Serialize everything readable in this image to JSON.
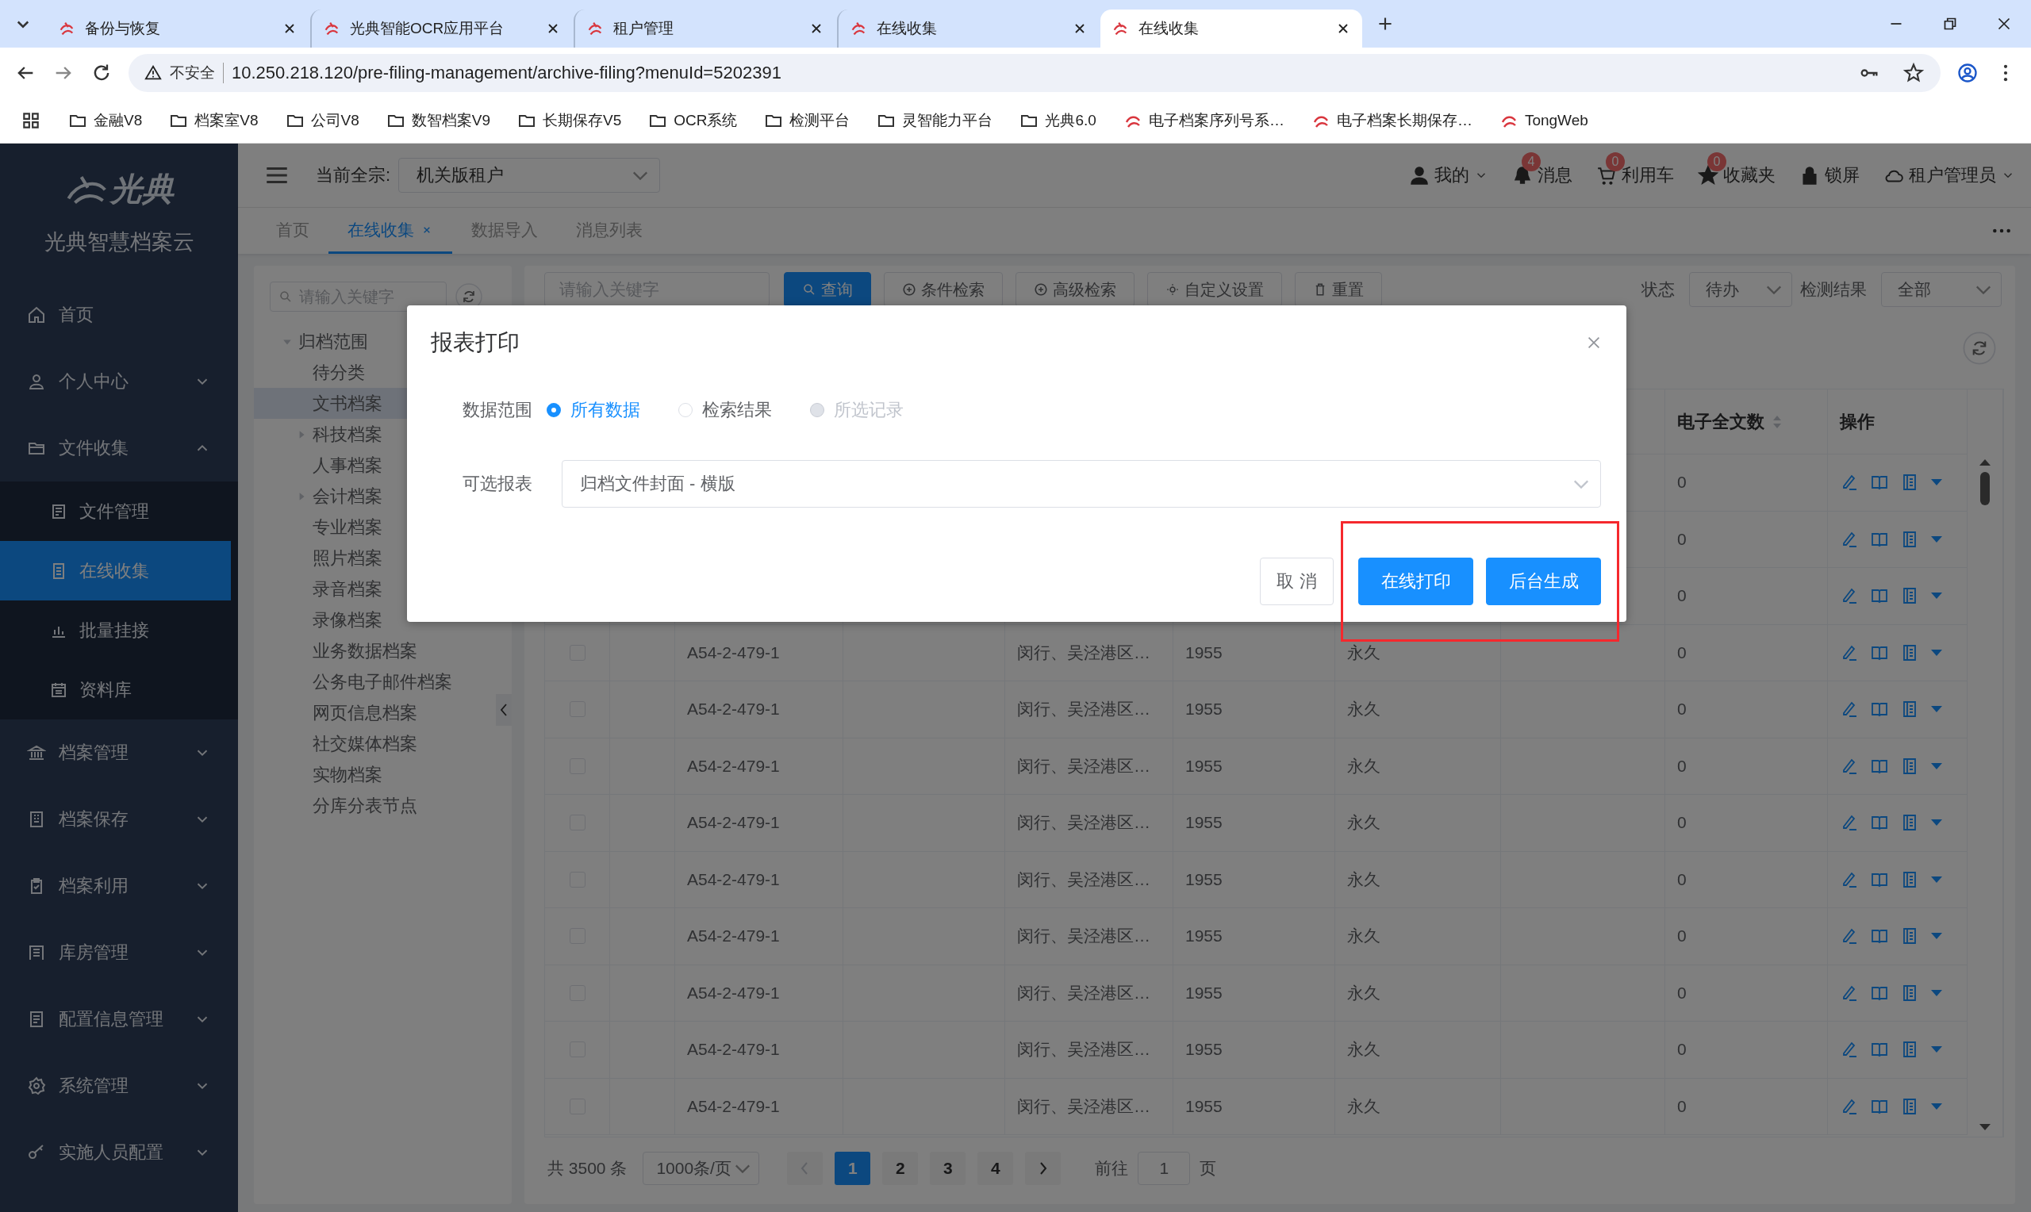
{
  "browser": {
    "tabs": [
      {
        "title": "备份与恢复",
        "selected": false
      },
      {
        "title": "光典智能OCR应用平台",
        "selected": false
      },
      {
        "title": "租户管理",
        "selected": false
      },
      {
        "title": "在线收集",
        "selected": false
      },
      {
        "title": "在线收集",
        "selected": true
      }
    ],
    "address": {
      "security": "不安全",
      "url": "10.250.218.120/pre-filing-management/archive-filing?menuId=5202391"
    },
    "bookmarks": [
      {
        "label": "金融V8",
        "kind": "folder"
      },
      {
        "label": "档案室V8",
        "kind": "folder"
      },
      {
        "label": "公司V8",
        "kind": "folder"
      },
      {
        "label": "数智档案V9",
        "kind": "folder"
      },
      {
        "label": "长期保存V5",
        "kind": "folder"
      },
      {
        "label": "OCR系统",
        "kind": "folder"
      },
      {
        "label": "检测平台",
        "kind": "folder"
      },
      {
        "label": "灵智能力平台",
        "kind": "folder"
      },
      {
        "label": "光典6.0",
        "kind": "folder"
      },
      {
        "label": "电子档案序列号系…",
        "kind": "page"
      },
      {
        "label": "电子档案长期保存…",
        "kind": "page"
      },
      {
        "label": "TongWeb",
        "kind": "page"
      }
    ]
  },
  "sidebar": {
    "logo": "光典",
    "title": "光典智慧档案云",
    "items": [
      {
        "label": "首页",
        "kind": "link",
        "selected": false
      },
      {
        "label": "个人中心",
        "kind": "group",
        "expanded": false
      },
      {
        "label": "文件收集",
        "kind": "group",
        "expanded": true,
        "children": [
          {
            "label": "文件管理",
            "selected": false
          },
          {
            "label": "在线收集",
            "selected": true
          },
          {
            "label": "批量挂接",
            "selected": false
          },
          {
            "label": "资料库",
            "selected": false
          }
        ]
      },
      {
        "label": "档案管理",
        "kind": "group",
        "expanded": false
      },
      {
        "label": "档案保存",
        "kind": "group",
        "expanded": false
      },
      {
        "label": "档案利用",
        "kind": "group",
        "expanded": false
      },
      {
        "label": "库房管理",
        "kind": "group",
        "expanded": false
      },
      {
        "label": "配置信息管理",
        "kind": "group",
        "expanded": false
      },
      {
        "label": "系统管理",
        "kind": "group",
        "expanded": false
      },
      {
        "label": "实施人员配置",
        "kind": "group",
        "expanded": false
      }
    ]
  },
  "header": {
    "fonds_label": "当前全宗:",
    "fonds": "机关版租户",
    "actions": [
      {
        "label": "我的",
        "kind": "user",
        "dropdown": true
      },
      {
        "label": "消息",
        "kind": "bell",
        "badge": "4",
        "dropdown": false
      },
      {
        "label": "利用车",
        "kind": "cart",
        "badge": "0",
        "dropdown": false
      },
      {
        "label": "收藏夹",
        "kind": "star",
        "badge": "0",
        "dropdown": false
      },
      {
        "label": "锁屏",
        "kind": "lock",
        "dropdown": false
      },
      {
        "label": "租户管理员",
        "kind": "cloud",
        "dropdown": true
      }
    ]
  },
  "page_tabs": [
    {
      "label": "首页",
      "selected": false,
      "closable": false
    },
    {
      "label": "在线收集",
      "selected": true,
      "closable": true
    },
    {
      "label": "数据导入",
      "selected": false,
      "closable": false
    },
    {
      "label": "消息列表",
      "selected": false,
      "closable": false
    }
  ],
  "tree": {
    "placeholder": "请输入关键字",
    "nodes": [
      {
        "label": "归档范围",
        "expanded": true,
        "selected": false,
        "children": [
          {
            "label": "待分类",
            "selected": false
          },
          {
            "label": "文书档案",
            "selected": true
          },
          {
            "label": "科技档案",
            "selected": false,
            "expanded": false
          },
          {
            "label": "人事档案",
            "selected": false
          },
          {
            "label": "会计档案",
            "selected": false,
            "expanded": false
          },
          {
            "label": "专业档案",
            "selected": false
          },
          {
            "label": "照片档案",
            "selected": false
          },
          {
            "label": "录音档案",
            "selected": false
          },
          {
            "label": "录像档案",
            "selected": false
          },
          {
            "label": "业务数据档案",
            "selected": false
          },
          {
            "label": "公务电子邮件档案",
            "selected": false
          },
          {
            "label": "网页信息档案",
            "selected": false
          },
          {
            "label": "社交媒体档案",
            "selected": false
          },
          {
            "label": "实物档案",
            "selected": false
          },
          {
            "label": "分库分表节点",
            "selected": false
          }
        ]
      }
    ]
  },
  "toolbar": {
    "placeholder": "请输入关键字",
    "buttons": [
      {
        "label": "查询",
        "kind": "primary"
      },
      {
        "label": "条件检索",
        "kind": "plain"
      },
      {
        "label": "高级检索",
        "kind": "plain"
      },
      {
        "label": "自定义设置",
        "kind": "plain"
      },
      {
        "label": "重置",
        "kind": "plain"
      }
    ],
    "filters": [
      {
        "label": "状态",
        "value": "待办"
      },
      {
        "label": "检测结果",
        "value": "全部"
      }
    ]
  },
  "table": {
    "columns": [
      {
        "label": "电子全文数",
        "sortable": true
      },
      {
        "label": "操作",
        "sortable": false
      }
    ],
    "rows": [
      {
        "count": "0"
      },
      {
        "count": "0"
      },
      {
        "count": "0"
      },
      {
        "checked": false,
        "code": "A54-2-479-1",
        "place": "闵行、吴泾港区…",
        "year": "1955",
        "term": "永久",
        "count": "0"
      },
      {
        "checked": false,
        "code": "A54-2-479-1",
        "place": "闵行、吴泾港区…",
        "year": "1955",
        "term": "永久",
        "count": "0"
      },
      {
        "checked": false,
        "code": "A54-2-479-1",
        "place": "闵行、吴泾港区…",
        "year": "1955",
        "term": "永久",
        "count": "0"
      },
      {
        "checked": false,
        "code": "A54-2-479-1",
        "place": "闵行、吴泾港区…",
        "year": "1955",
        "term": "永久",
        "count": "0"
      },
      {
        "checked": false,
        "code": "A54-2-479-1",
        "place": "闵行、吴泾港区…",
        "year": "1955",
        "term": "永久",
        "count": "0"
      },
      {
        "checked": false,
        "code": "A54-2-479-1",
        "place": "闵行、吴泾港区…",
        "year": "1955",
        "term": "永久",
        "count": "0"
      },
      {
        "checked": false,
        "code": "A54-2-479-1",
        "place": "闵行、吴泾港区…",
        "year": "1955",
        "term": "永久",
        "count": "0"
      },
      {
        "checked": false,
        "code": "A54-2-479-1",
        "place": "闵行、吴泾港区…",
        "year": "1955",
        "term": "永久",
        "count": "0"
      },
      {
        "checked": false,
        "code": "A54-2-479-1",
        "place": "闵行、吴泾港区…",
        "year": "1955",
        "term": "永久",
        "count": "0"
      }
    ]
  },
  "pagination": {
    "total": "共 3500 条",
    "page_size": "1000条/页",
    "pages": [
      {
        "label": "1",
        "selected": true
      },
      {
        "label": "2",
        "selected": false
      },
      {
        "label": "3",
        "selected": false
      },
      {
        "label": "4",
        "selected": false
      }
    ],
    "goto_label": "前往",
    "goto_value": "1",
    "goto_suffix": "页"
  },
  "dialog": {
    "title": "报表打印",
    "fields": [
      {
        "label": "数据范围",
        "kind": "radio",
        "options": [
          {
            "label": "所有数据",
            "selected": true,
            "disabled": false
          },
          {
            "label": "检索结果",
            "selected": false,
            "disabled": false
          },
          {
            "label": "所选记录",
            "selected": false,
            "disabled": true
          }
        ]
      },
      {
        "label": "可选报表",
        "kind": "select",
        "value": "归档文件封面 - 横版"
      }
    ],
    "buttons": [
      {
        "label": "取 消",
        "kind": "plain"
      },
      {
        "label": "在线打印",
        "kind": "primary"
      },
      {
        "label": "后台生成",
        "kind": "primary"
      }
    ],
    "highlight_primary": true
  }
}
